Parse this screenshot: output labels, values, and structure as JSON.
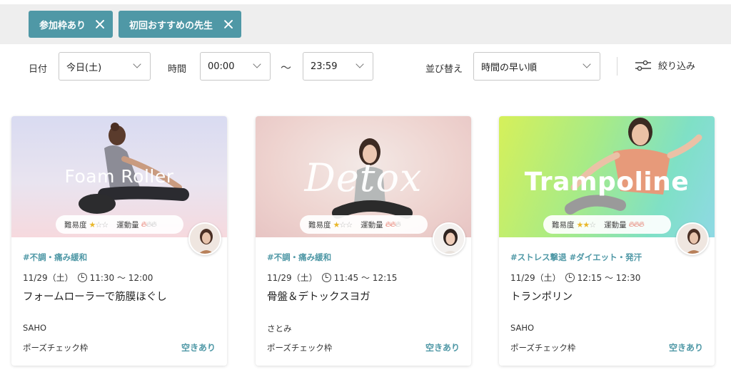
{
  "chips": [
    {
      "label": "参加枠あり"
    },
    {
      "label": "初回おすすめの先生"
    }
  ],
  "filters": {
    "date_label": "日付",
    "date_value": "今日(土)",
    "time_label": "時間",
    "time_from": "00:00",
    "tilde": "〜",
    "time_to": "23:59",
    "sort_label": "並び替え",
    "sort_value": "時間の早い順",
    "refine_label": "絞り込み"
  },
  "colors": {
    "accent": "#4f98a6"
  },
  "cards": [
    {
      "image_title": "Foam Roller",
      "difficulty_label": "難易度",
      "difficulty": 1,
      "intensity_label": "運動量",
      "intensity": 1,
      "tags": "#不調・痛み緩和",
      "date": "11/29（土）",
      "time": "11:30 〜 12:00",
      "title": "フォームローラーで筋膜ほぐし",
      "teacher": "SAHO",
      "slot": "ポーズチェック枠",
      "status": "空きあり"
    },
    {
      "image_title": "Detox",
      "difficulty_label": "難易度",
      "difficulty": 1,
      "intensity_label": "運動量",
      "intensity": 2,
      "tags": "#不調・痛み緩和",
      "date": "11/29（土）",
      "time": "11:45 〜 12:15",
      "title": "骨盤＆デトックスヨガ",
      "teacher": "さとみ",
      "slot": "ポーズチェック枠",
      "status": "空きあり"
    },
    {
      "image_title": "Trampoline",
      "difficulty_label": "難易度",
      "difficulty": 2,
      "intensity_label": "運動量",
      "intensity": 3,
      "tags": "#ストレス撃退 #ダイエット・発汗",
      "date": "11/29（土）",
      "time": "12:15 〜 12:30",
      "title": "トランポリン",
      "teacher": "SAHO",
      "slot": "ポーズチェック枠",
      "status": "空きあり"
    }
  ]
}
